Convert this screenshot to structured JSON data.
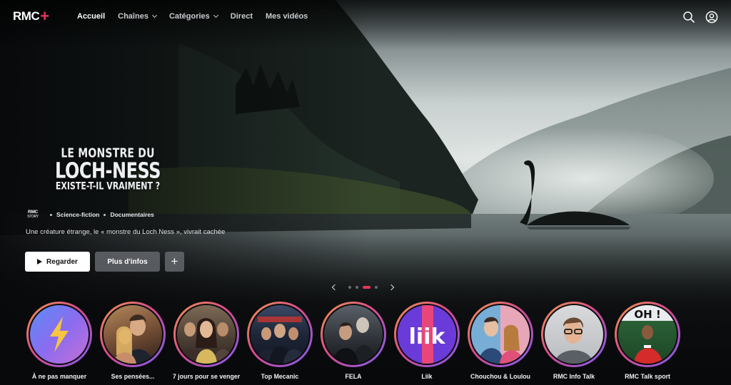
{
  "header": {
    "logo_text": "RMC",
    "logo_plus": "+",
    "nav": [
      {
        "label": "Accueil",
        "active": true
      },
      {
        "label": "Chaînes",
        "dropdown": true
      },
      {
        "label": "Catégories",
        "dropdown": true
      },
      {
        "label": "Direct"
      },
      {
        "label": "Mes vidéos"
      }
    ],
    "icons": [
      "search-icon",
      "account-icon"
    ]
  },
  "hero": {
    "title_line1": "LE MONSTRE DU",
    "title_line2": "LOCH-NESS",
    "title_line3": "EXISTE-T-IL VRAIMENT ?",
    "channel_badge_line1": "RMC",
    "channel_badge_line2": "STORY",
    "genres": [
      "Science-fiction",
      "Documentaires"
    ],
    "synopsis": "Une créature étrange, le « monstre du Loch Ness », vivrait cachée",
    "buttons": {
      "watch": "Regarder",
      "info": "Plus d'infos",
      "add": "+"
    },
    "pager": {
      "count": 4,
      "active_index": 2
    }
  },
  "rail": [
    {
      "label": "À ne pas manquer",
      "icon": "lightning-icon"
    },
    {
      "label": "Ses pensées..."
    },
    {
      "label": "7 jours pour se venger"
    },
    {
      "label": "Top Mecanic"
    },
    {
      "label": "FELA"
    },
    {
      "label": "Liik",
      "logo_text": "liik"
    },
    {
      "label": "Chouchou & Loulou"
    },
    {
      "label": "RMC Info Talk"
    },
    {
      "label": "RMC Talk sport",
      "banner": "OH !"
    }
  ],
  "colors": {
    "accent": "#e5355b",
    "ring_start": "#f19a4b",
    "ring_mid": "#d84a8b",
    "ring_end": "#7d5cf0",
    "background": "#0b0c0f"
  }
}
